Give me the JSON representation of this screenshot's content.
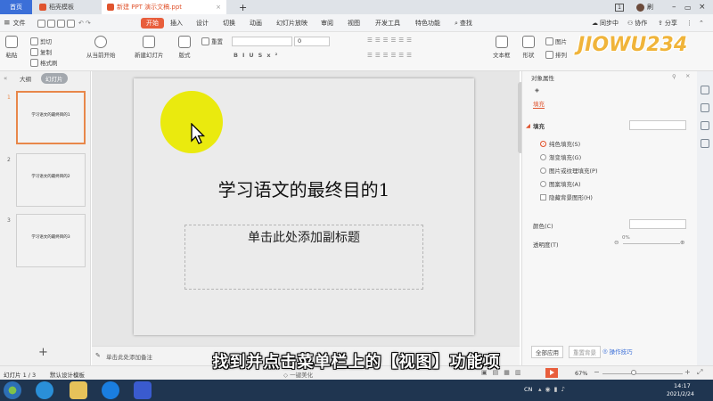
{
  "titlebar": {
    "tabs": [
      {
        "label": "首页"
      },
      {
        "label": "稻壳模板"
      },
      {
        "label": "新建 PPT 演示文稿.ppt"
      }
    ],
    "add_tab": "+",
    "user_label": "刷"
  },
  "menubar": {
    "file": "文件",
    "items": [
      "开始",
      "插入",
      "设计",
      "切换",
      "动画",
      "幻灯片放映",
      "审阅",
      "视图",
      "开发工具",
      "特色功能"
    ],
    "search": "查找",
    "sync": "同步中",
    "collab": "协作",
    "share": "分享"
  },
  "ribbon": {
    "paste": "粘贴",
    "cut": "剪切",
    "copy": "复制",
    "format_painter": "格式刷",
    "play_from_current": "从当前开始",
    "new_slide": "新建幻灯片",
    "layout": "版式",
    "reset": "重置",
    "font_size_value": "0",
    "text_box": "文本框",
    "shape": "形状",
    "arrange": "排列",
    "picture": "图片"
  },
  "leftpane": {
    "tabs": [
      "大纲",
      "幻灯片"
    ],
    "slides": [
      {
        "num": "1",
        "text": "学习语文的最终目的1"
      },
      {
        "num": "2",
        "text": "学习语文的最终目的2"
      },
      {
        "num": "3",
        "text": "学习语文的最终目的3"
      }
    ],
    "add_slide": "+"
  },
  "slide": {
    "title": "学习语文的最终目的1",
    "subtitle_placeholder": "单击此处添加副标题"
  },
  "rightpane": {
    "header": "对象属性",
    "tab": "填充",
    "section": "填充",
    "fill_options": [
      "纯色填充(S)",
      "渐变填充(G)",
      "图片或纹理填充(P)",
      "图案填充(A)"
    ],
    "hide_bg": "隐藏背景图形(H)",
    "color_label": "颜色(C)",
    "transparency_label": "透明度(T)",
    "transparency_value": "0%",
    "apply_all": "全部应用",
    "reset_bg": "重置背景",
    "tips": "操作技巧"
  },
  "notes": {
    "placeholder": "单击此处添加备注"
  },
  "statusbar": {
    "slide_info": "幻灯片 1 / 3",
    "template": "默认设计模板",
    "beautify": "一键美化",
    "zoom": "67%"
  },
  "taskbar": {
    "time": "14:17",
    "date": "2021/2/24",
    "lang": "CN"
  },
  "overlay": {
    "caption": "找到并点击菜单栏上的【视图】功能项",
    "watermark": "JIOWU234"
  },
  "colors": {
    "accent": "#e85e3c",
    "highlight": "#eaea0e",
    "taskbar": "#1f3550"
  }
}
